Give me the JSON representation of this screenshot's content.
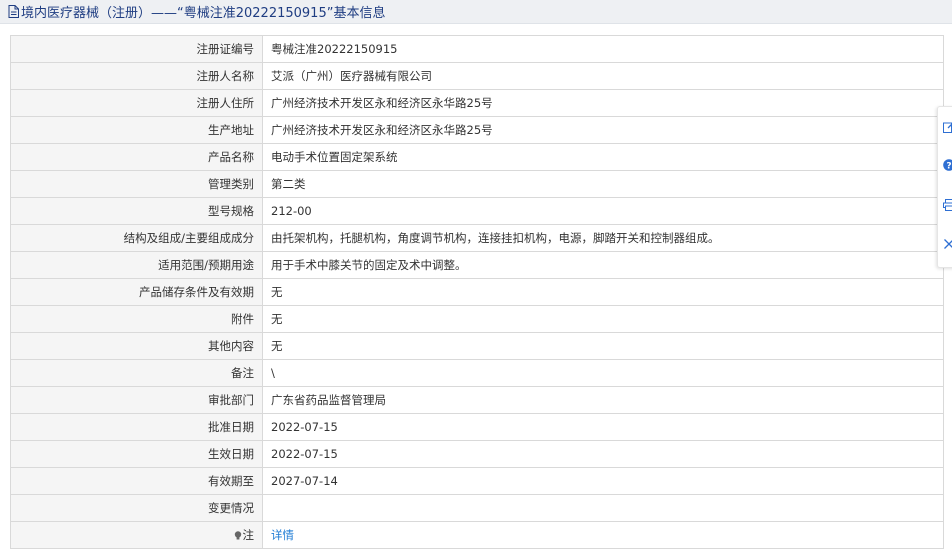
{
  "header": {
    "title": "境内医疗器械（注册）——“粤械注准20222150915”基本信息"
  },
  "rows": [
    {
      "label": "注册证编号",
      "value": "粤械注准20222150915"
    },
    {
      "label": "注册人名称",
      "value": "艾派（广州）医疗器械有限公司"
    },
    {
      "label": "注册人住所",
      "value": "广州经济技术开发区永和经济区永华路25号"
    },
    {
      "label": "生产地址",
      "value": "广州经济技术开发区永和经济区永华路25号"
    },
    {
      "label": "产品名称",
      "value": "电动手术位置固定架系统"
    },
    {
      "label": "管理类别",
      "value": "第二类"
    },
    {
      "label": "型号规格",
      "value": "212-00"
    },
    {
      "label": "结构及组成/主要组成成分",
      "value": "由托架机构，托腿机构，角度调节机构，连接挂扣机构，电源，脚踏开关和控制器组成。"
    },
    {
      "label": "适用范围/预期用途",
      "value": "用于手术中膝关节的固定及术中调整。"
    },
    {
      "label": "产品储存条件及有效期",
      "value": "无"
    },
    {
      "label": "附件",
      "value": "无"
    },
    {
      "label": "其他内容",
      "value": "无"
    },
    {
      "label": "备注",
      "value": "\\"
    },
    {
      "label": "审批部门",
      "value": "广东省药品监督管理局"
    },
    {
      "label": "批准日期",
      "value": "2022-07-15"
    },
    {
      "label": "生效日期",
      "value": "2022-07-15"
    },
    {
      "label": "有效期至",
      "value": "2027-07-14"
    },
    {
      "label": "变更情况",
      "value": ""
    }
  ],
  "note_row": {
    "label": "注",
    "link": "详情"
  },
  "side_toolbar": {
    "icons": [
      "edit-icon",
      "help-icon",
      "print-icon",
      "close-icon"
    ]
  },
  "colors": {
    "title_text": "#1f3d82",
    "title_bg": "#eef0f3",
    "label_bg": "#f5f5f5",
    "border": "#d9d9d9",
    "link": "#1e7bd4",
    "toolbar_icon": "#2e6fd3"
  }
}
